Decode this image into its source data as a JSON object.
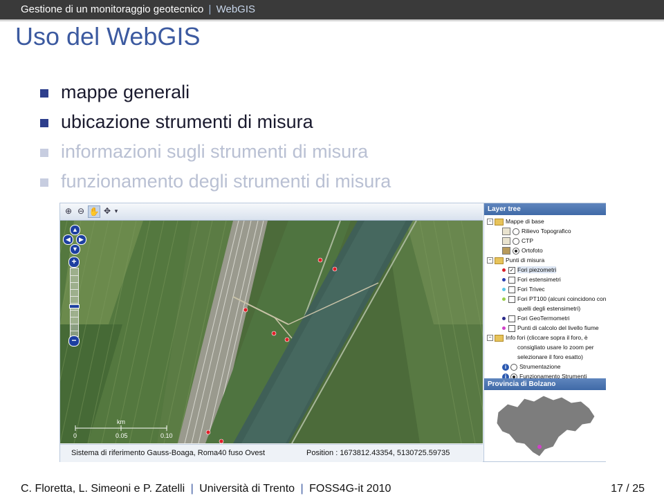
{
  "header": {
    "talk_title": "Gestione di un monitoraggio geotecnico",
    "separator": "|",
    "section": "WebGIS"
  },
  "slide_title": "Uso del WebGIS",
  "bullets": [
    {
      "text": "mappe generali",
      "active": true
    },
    {
      "text": "ubicazione strumenti di misura",
      "active": true
    },
    {
      "text": "informazioni sugli strumenti di misura",
      "active": false
    },
    {
      "text": "funzionamento degli strumenti di misura",
      "active": false
    }
  ],
  "webgis": {
    "map": {
      "scale_labels": {
        "unit": "km",
        "s0": "0",
        "s1": "0.05",
        "s2": "0.10"
      },
      "markers_color": "#e0202a"
    },
    "status": {
      "reference_system": "Sistema di riferimento Gauss-Boaga, Roma40 fuso Ovest",
      "position_label": "Position :",
      "position_value": "1673812.43354, 5130725.59735"
    },
    "layer_tree": {
      "title": "Layer tree",
      "base_group": "Mappe di base",
      "base_layers": [
        "Rilievo Topografico",
        "CTP",
        "Ortofoto"
      ],
      "measure_group": "Punti di misura",
      "measure_layers": [
        {
          "label": "Fori piezometri",
          "color": "#d9202a",
          "checked": true
        },
        {
          "label": "Fori estensimetri",
          "color": "#2a3fb0",
          "checked": false
        },
        {
          "label": "Fori Trivec",
          "color": "#5ac8e8",
          "checked": false
        },
        {
          "label": "Fori PT100 (alcuni coincidono con",
          "color": "#9ad04a",
          "checked": false
        },
        {
          "label": "quelli degli estensimetri)",
          "color": "",
          "checked": false
        },
        {
          "label": "Fori GeoTermometri",
          "color": "#2a2a8a",
          "checked": false
        },
        {
          "label": "Punti di calcolo del livello fiume",
          "color": "#d040c8",
          "checked": false
        }
      ],
      "info_group": "Info fori (cliccare sopra il foro, è",
      "info_lines": [
        "consigliato usare lo zoom per",
        "selezionare il foro esatto)"
      ],
      "info_layers": [
        "Strumentazione",
        "Funzionamento Strumenti"
      ]
    },
    "overview": {
      "title": "Provincia di Bolzano"
    }
  },
  "footer": {
    "authors": "C. Floretta, L. Simeoni e P. Zatelli",
    "separator": "|",
    "university": "Università di Trento",
    "conference": "FOSS4G-it 2010",
    "page": "17 / 25"
  }
}
